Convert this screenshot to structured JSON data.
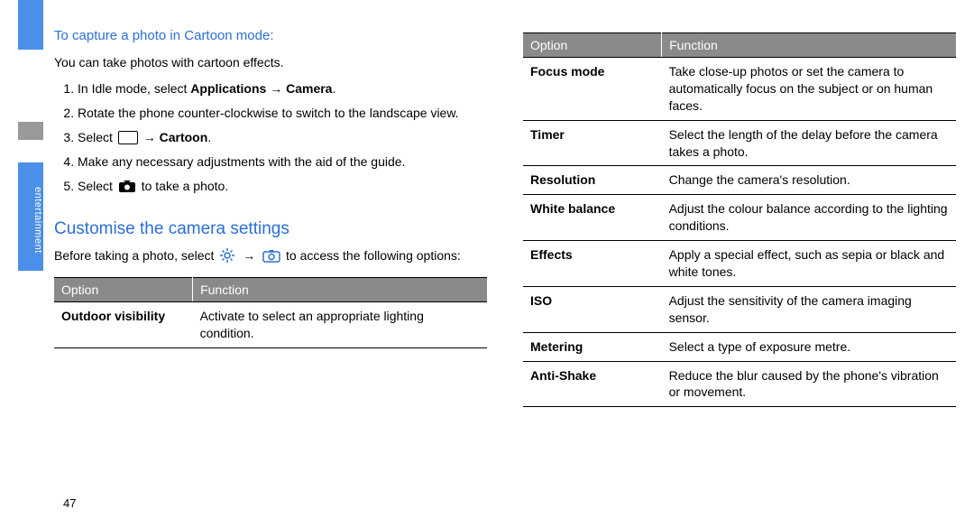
{
  "sidebar": {
    "label": "entertainment"
  },
  "page_number": "47",
  "left": {
    "heading1": "To capture a photo in Cartoon mode:",
    "intro": "You can take photos with cartoon effects.",
    "steps": {
      "s1_a": "In Idle mode, select ",
      "s1_b": "Applications",
      "s1_arrow": " → ",
      "s1_c": "Camera",
      "s1_d": ".",
      "s2": "Rotate the phone counter-clockwise to switch to the landscape view.",
      "s3_a": "Select ",
      "s3_arrow": " → ",
      "s3_b": "Cartoon",
      "s3_c": ".",
      "s4": "Make any necessary adjustments with the aid of the guide.",
      "s5_a": "Select ",
      "s5_b": " to take a photo."
    },
    "heading2": "Customise the camera settings",
    "before_a": "Before taking a photo, select ",
    "before_arrow": " → ",
    "before_b": " to access the following options:",
    "table": {
      "h_option": "Option",
      "h_function": "Function",
      "rows": [
        {
          "option": "Outdoor visibility",
          "function": "Activate to select an appropriate lighting condition."
        }
      ]
    }
  },
  "right": {
    "table": {
      "h_option": "Option",
      "h_function": "Function",
      "rows": [
        {
          "option": "Focus mode",
          "function": "Take close-up photos or set the camera to automatically focus on the subject or on human faces."
        },
        {
          "option": "Timer",
          "function": "Select the length of the delay before the camera takes a photo."
        },
        {
          "option": "Resolution",
          "function": "Change the camera's resolution."
        },
        {
          "option": "White balance",
          "function": "Adjust the colour balance according to the lighting conditions."
        },
        {
          "option": "Effects",
          "function": "Apply a special effect, such as sepia or black and white tones."
        },
        {
          "option": "ISO",
          "function": "Adjust the sensitivity of the camera imaging sensor."
        },
        {
          "option": "Metering",
          "function": "Select a type of exposure metre."
        },
        {
          "option": "Anti-Shake",
          "function": "Reduce the blur caused by the phone's vibration or movement."
        }
      ]
    }
  }
}
